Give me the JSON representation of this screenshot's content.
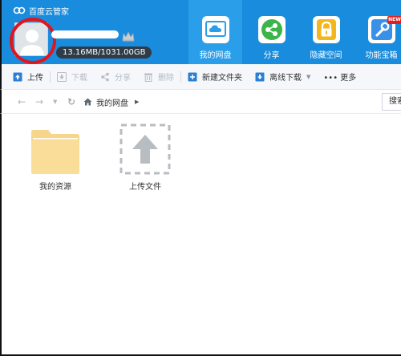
{
  "app": {
    "title": "百度云管家"
  },
  "account": {
    "quota": "13.16MB/1031.00GB"
  },
  "nav": [
    {
      "label": "我的网盘",
      "icon": "cloud-drive-icon",
      "active": true
    },
    {
      "label": "分享",
      "icon": "share-icon",
      "active": false
    },
    {
      "label": "隐藏空间",
      "icon": "lock-icon",
      "active": false
    },
    {
      "label": "功能宝箱",
      "icon": "wrench-icon",
      "active": false,
      "badge": "NEW"
    }
  ],
  "toolbar": {
    "upload": "上传",
    "download": "下载",
    "share": "分享",
    "delete": "删除",
    "new_folder": "新建文件夹",
    "offline_download": "离线下载",
    "more": "••• 更多"
  },
  "address": {
    "path": "我的网盘",
    "search_placeholder": "搜索"
  },
  "files": [
    {
      "name": "我的资源",
      "type": "folder"
    },
    {
      "name": "上传文件",
      "type": "upload"
    }
  ],
  "colors": {
    "header_bg": "#1a8cde",
    "nav_active_bg": "#2b9eea",
    "highlight_ring": "#e0161d",
    "folder": "#f7d58b",
    "share_icon": "#3cb44a",
    "lock_icon": "#f3b61c",
    "tools_icon": "#3a8fe6"
  }
}
